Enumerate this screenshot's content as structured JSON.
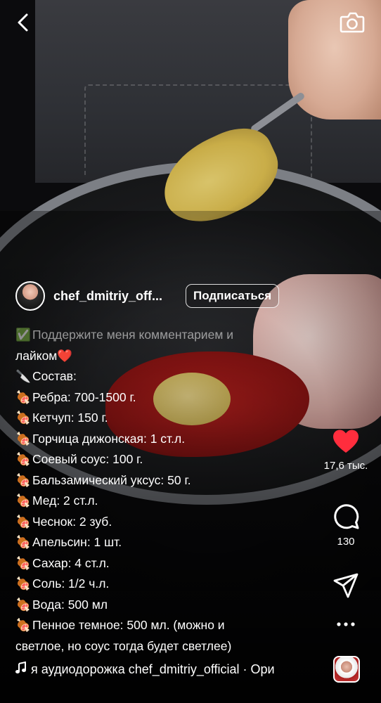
{
  "author": {
    "username": "chef_dmitriy_off...",
    "follow_label": "Подписаться"
  },
  "caption": {
    "lines": [
      {
        "emoji": "✅",
        "text": "Поддержите меня комментарием и"
      },
      {
        "emoji": "",
        "text": "лайком❤️"
      },
      {
        "emoji": "🔪",
        "text": "Состав:"
      },
      {
        "emoji": "🍖",
        "text": "Ребра: 700-1500 г."
      },
      {
        "emoji": "🍖",
        "text": "Кетчуп: 150 г."
      },
      {
        "emoji": "🍖",
        "text": "Горчица дижонская: 1 ст.л."
      },
      {
        "emoji": "🍖",
        "text": "Соевый соус: 100 г."
      },
      {
        "emoji": "🍖",
        "text": "Бальзамический уксус: 50 г."
      },
      {
        "emoji": "🍖",
        "text": "Мед: 2 ст.л."
      },
      {
        "emoji": "🍖",
        "text": "Чеснок: 2 зуб."
      },
      {
        "emoji": "🍖",
        "text": "Апельсин: 1 шт."
      },
      {
        "emoji": "🍖",
        "text": "Сахар: 4 ст.л."
      },
      {
        "emoji": "🍖",
        "text": "Соль: 1/2 ч.л."
      },
      {
        "emoji": "🍖",
        "text": "Вода: 500 мл"
      },
      {
        "emoji": "🍖",
        "text": "Пенное темное: 500 мл. (можно и"
      },
      {
        "emoji": "",
        "text": "светлое, но соус тогда будет светлее)"
      }
    ]
  },
  "actions": {
    "likes": "17,6 тыс.",
    "comments": "130"
  },
  "audio": {
    "text": "я аудиодорожка  chef_dmitriy_official · Ори"
  },
  "colors": {
    "like_red": "#ff2d3d",
    "text": "#ffffff"
  },
  "icons": [
    "back-arrow-icon",
    "camera-icon",
    "heart-icon",
    "comment-icon",
    "share-icon",
    "more-icon",
    "music-note-icon"
  ]
}
